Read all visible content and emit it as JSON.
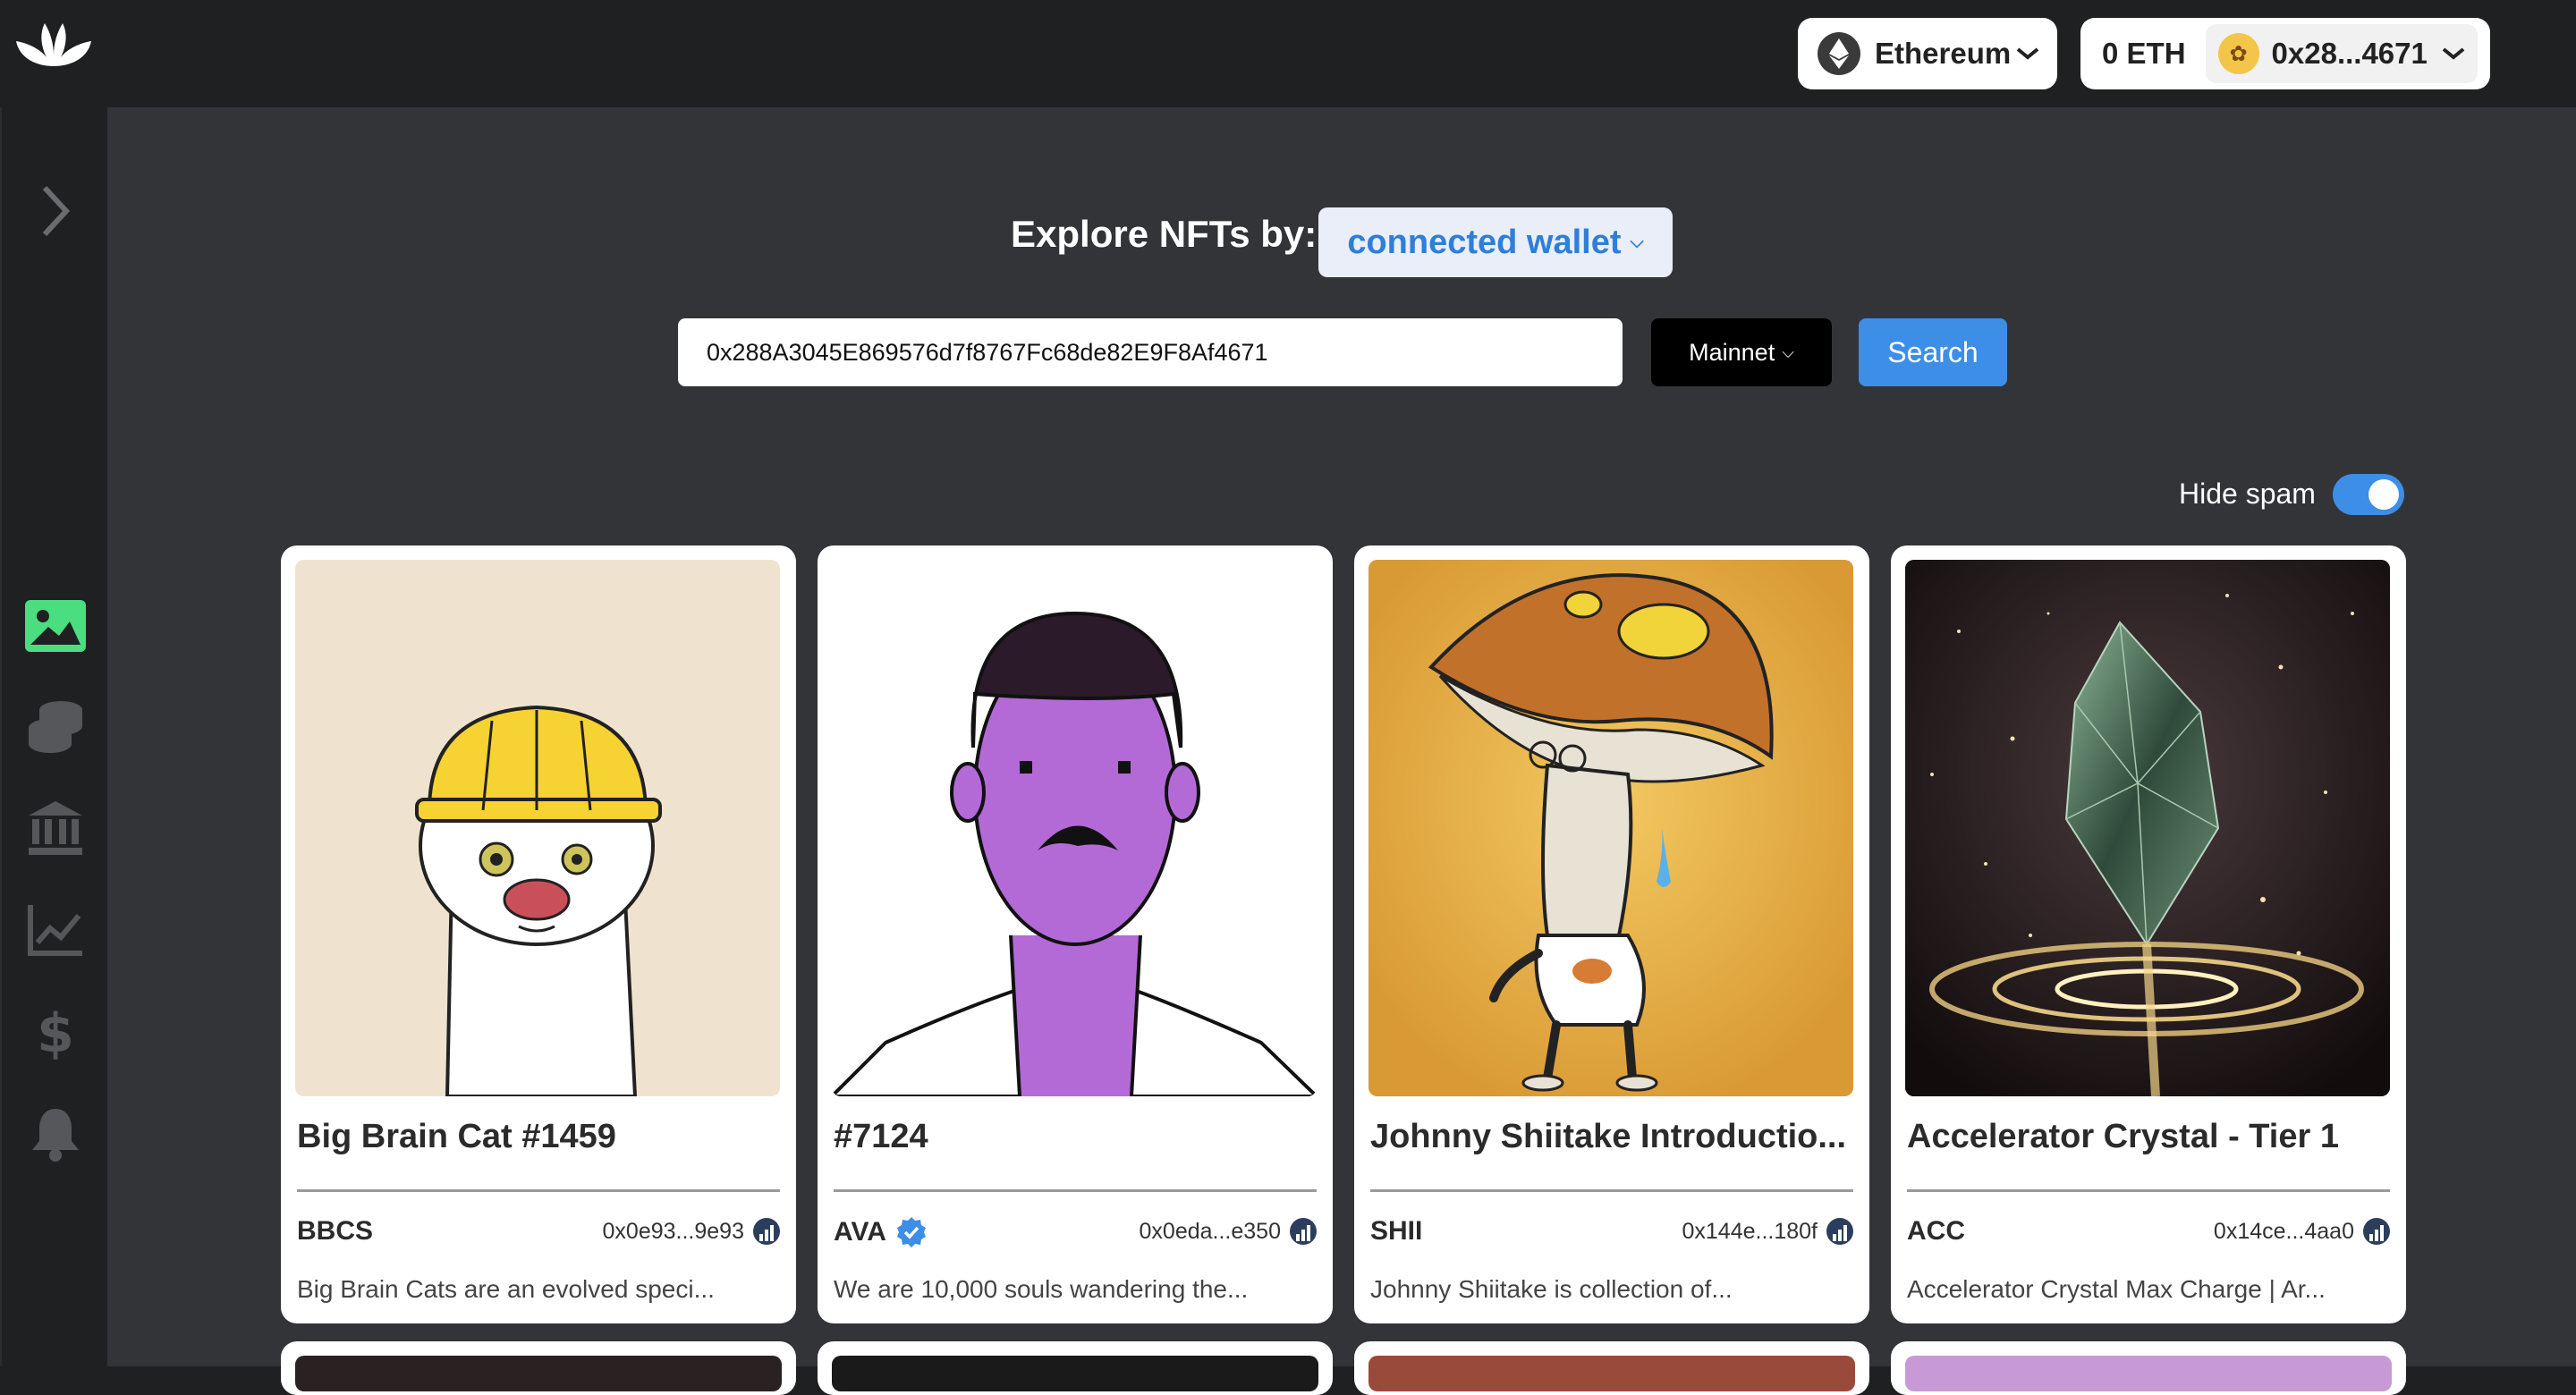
{
  "topbar": {
    "network_label": "Ethereum",
    "balance": "0 ETH",
    "wallet_short": "0x28...4671"
  },
  "sidebar": {
    "items": [
      {
        "name": "expand",
        "icon": "chevron-right-icon"
      },
      {
        "name": "nfts",
        "icon": "image-icon",
        "active": true
      },
      {
        "name": "tokens",
        "icon": "coins-icon"
      },
      {
        "name": "defi",
        "icon": "bank-icon"
      },
      {
        "name": "charts",
        "icon": "line-chart-icon"
      },
      {
        "name": "prices",
        "icon": "dollar-icon"
      },
      {
        "name": "alerts",
        "icon": "bell-icon"
      }
    ]
  },
  "explore": {
    "label": "Explore NFTs by:",
    "mode": "connected wallet",
    "address_value": "0x288A3045E869576d7f8767Fc68de82E9F8Af4671",
    "network": "Mainnet",
    "search_label": "Search",
    "hide_spam_label": "Hide spam",
    "hide_spam_on": true
  },
  "colors": {
    "accent": "#3d8ee6",
    "sidebar_active": "#4ade80",
    "main_bg": "#333438",
    "topbar_bg": "#1f2022"
  },
  "cards": [
    {
      "title": "Big Brain Cat #1459",
      "symbol": "BBCS",
      "verified": false,
      "contract": "0x0e93...9e93",
      "description": "Big Brain Cats are an evolved speci...",
      "image": "cat-with-hard-hat"
    },
    {
      "title": "#7124",
      "symbol": "AVA",
      "verified": true,
      "contract": "0x0eda...e350",
      "description": "We are 10,000 souls wandering the...",
      "image": "purple-face-sketch"
    },
    {
      "title": "Johnny Shiitake Introductio...",
      "symbol": "SHII",
      "verified": false,
      "contract": "0x144e...180f",
      "description": "Johnny Shiitake is collection of...",
      "image": "mushroom-character"
    },
    {
      "title": "Accelerator Crystal - Tier 1",
      "symbol": "ACC",
      "verified": false,
      "contract": "0x14ce...4aa0",
      "description": "Accelerator Crystal Max Charge | Ar...",
      "image": "green-crystal"
    }
  ]
}
